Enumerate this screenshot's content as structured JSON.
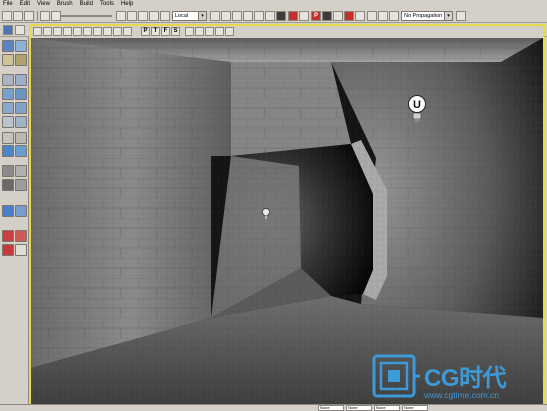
{
  "menu": [
    "File",
    "Edit",
    "View",
    "Brush",
    "Build",
    "Tools",
    "Help"
  ],
  "toolbar": {
    "coord_system": "Local",
    "propagation": "No Propagation",
    "letter_button": "P"
  },
  "viewport_toolbar": {
    "mode_buttons": [
      "P",
      "T",
      "F",
      "S"
    ]
  },
  "viewport": {
    "light_actor_label": "U",
    "icons": [
      "light-bulb-icon",
      "pathnode-icon"
    ]
  },
  "statusbar": {
    "fields": [
      "None",
      "None",
      "None",
      "None"
    ]
  },
  "watermark": {
    "brand": "CG时代",
    "url": "www.cgtime.com.cn"
  }
}
